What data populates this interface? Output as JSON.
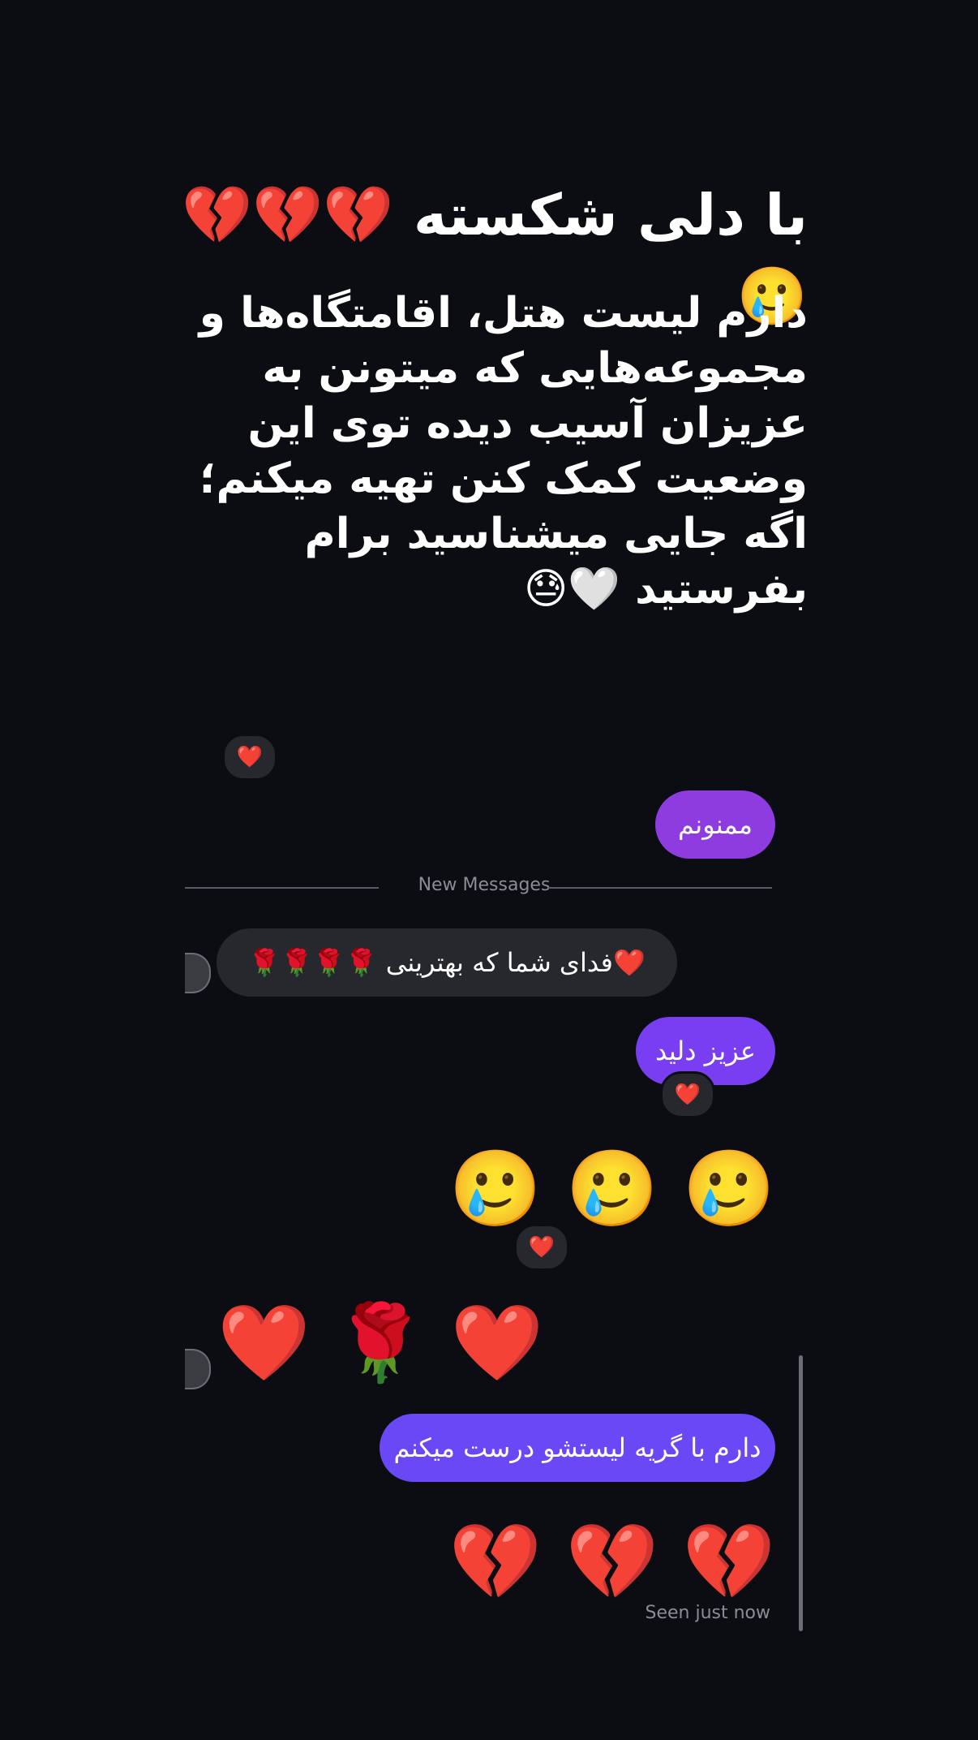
{
  "post": {
    "headline": "با دلی شکسته 💔💔💔🥲",
    "body": "دارم لیست هتل، اقامتگاه‌ها و مجموعه‌هایی که میتونن به عزیزان آسیب دیده توی این وضعیت کمک کنن تهیه میکنم؛ اگه جایی میشناسید برام بفرستید 🤍😓"
  },
  "chat": {
    "top_reaction": "❤️",
    "msg_thanks": "ممنونم",
    "divider": "New Messages",
    "msg_received_1": "❤️فدای شما که بهترینی 🌹🌹🌹🌹",
    "msg_dear": "عزیز دلید",
    "reaction_dear": "❤️",
    "tear_faces": "🥲 🥲 🥲",
    "reaction_faces": "❤️",
    "heart_rose_heart": "❤️ 🌹 ❤️",
    "msg_crying": "دارم با گریه لیستشو درست میکنم",
    "broken_hearts": "💔 💔 💔",
    "seen": "Seen just now"
  }
}
